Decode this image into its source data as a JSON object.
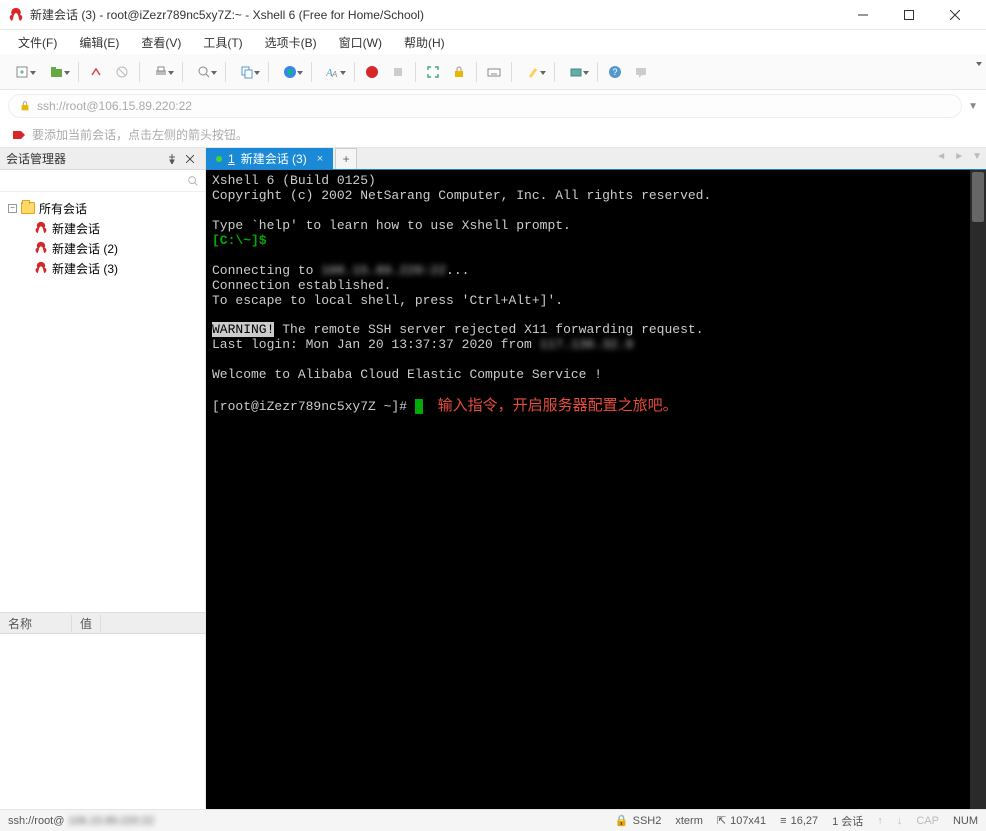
{
  "window": {
    "title": "新建会话 (3) - root@iZezr789nc5xy7Z:~ - Xshell 6 (Free for Home/School)"
  },
  "menu": {
    "file": "文件(F)",
    "edit": "编辑(E)",
    "view": "查看(V)",
    "tools": "工具(T)",
    "tabs": "选项卡(B)",
    "window": "窗口(W)",
    "help": "帮助(H)"
  },
  "address": {
    "url": "ssh://root@106.15.89.220:22"
  },
  "hint": {
    "text": "要添加当前会话，点击左侧的箭头按钮。"
  },
  "sidebar": {
    "title": "会话管理器",
    "root": "所有会话",
    "items": [
      {
        "label": "新建会话"
      },
      {
        "label": "新建会话 (2)"
      },
      {
        "label": "新建会话 (3)"
      }
    ],
    "prop_name": "名称",
    "prop_value": "值"
  },
  "tab": {
    "num": "1",
    "label": "新建会话 (3)",
    "add": "+"
  },
  "terminal": {
    "l1": "Xshell 6 (Build 0125)",
    "l2": "Copyright (c) 2002 NetSarang Computer, Inc. All rights reserved.",
    "l3": "Type `help' to learn how to use Xshell prompt.",
    "l4": "[C:\\~]$",
    "l5a": "Connecting to ",
    "l5b": "106.15.89.220:22",
    "l5c": "...",
    "l6": "Connection established.",
    "l7": "To escape to local shell, press 'Ctrl+Alt+]'.",
    "l8a": "WARNING!",
    "l8b": " The remote SSH server rejected X11 forwarding request.",
    "l9a": "Last login: Mon Jan 20 13:37:37 2020 from ",
    "l9b": "117.136.32.9",
    "l10": "Welcome to Alibaba Cloud Elastic Compute Service !",
    "l11a": "[root@iZezr789nc5xy7Z ~]# ",
    "cursor": " ",
    "note": "    输入指令，开启服务器配置之旅吧。"
  },
  "status": {
    "left_a": "ssh://root@",
    "left_blur": "106.15.89.220:22",
    "ssh": "SSH2",
    "term": "xterm",
    "size_icon": "⇱",
    "size": "107x41",
    "pos_icon": "≡",
    "pos": "16,27",
    "sess": "1 会话",
    "up": "↑",
    "dn": "↓",
    "cap": "CAP",
    "num": "NUM"
  }
}
